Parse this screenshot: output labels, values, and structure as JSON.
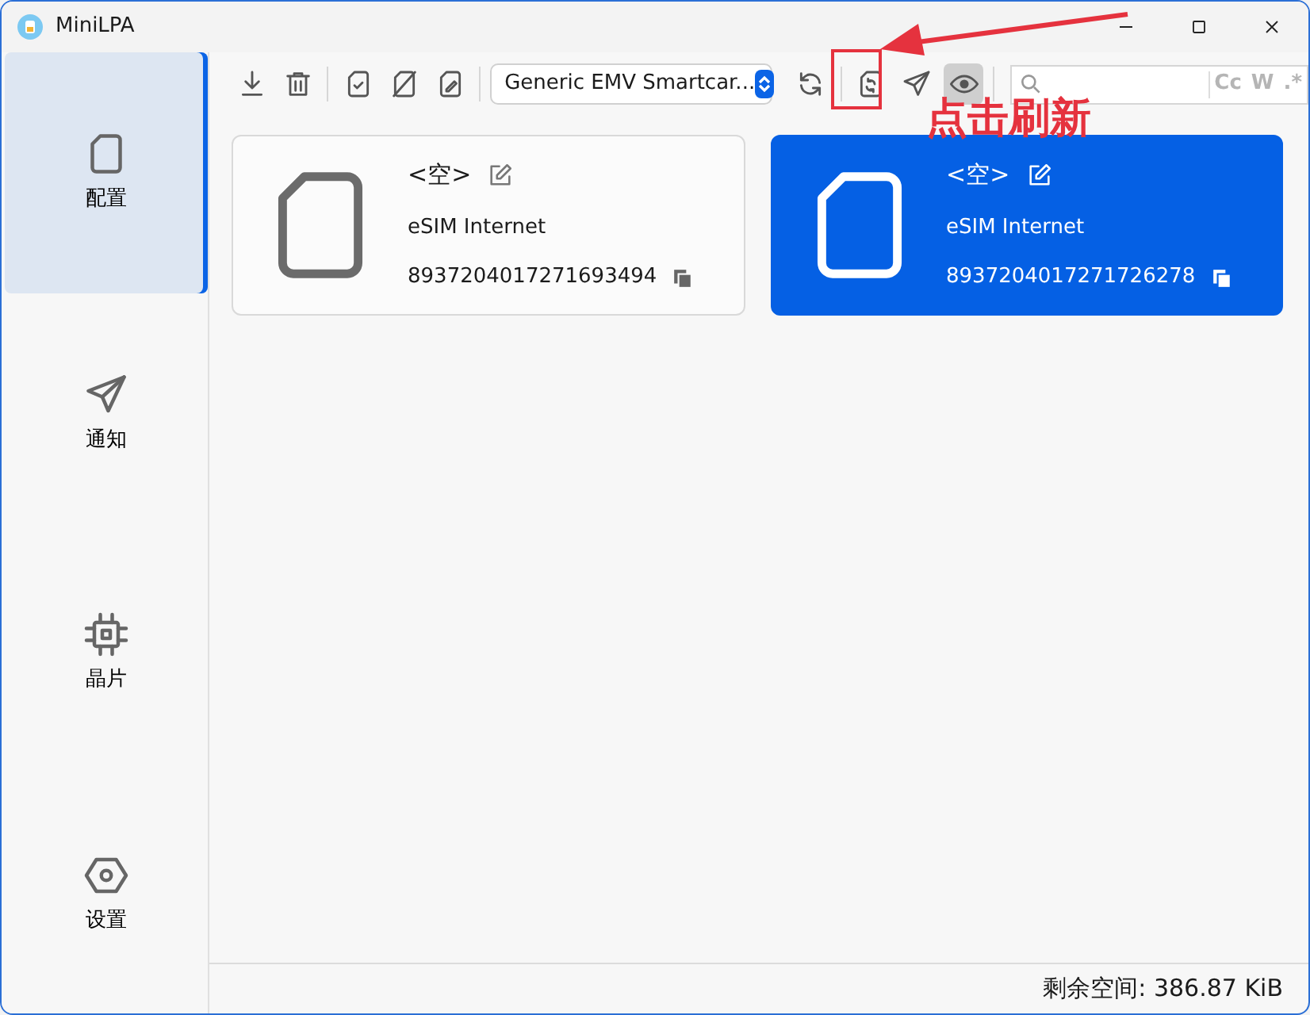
{
  "window": {
    "title": "MiniLPA"
  },
  "sidebar": {
    "items": [
      {
        "label": "配置",
        "kind": "sim",
        "selected": true
      },
      {
        "label": "通知",
        "kind": "plane",
        "selected": false
      },
      {
        "label": "晶片",
        "kind": "chip",
        "selected": false
      },
      {
        "label": "设置",
        "kind": "gear",
        "selected": false
      }
    ]
  },
  "toolbar": {
    "reader": "Generic EMV Smartcar...",
    "eye_on": true,
    "search_toggles": [
      "Cc",
      "W",
      ".*"
    ]
  },
  "profiles": [
    {
      "name": "<空>",
      "description": "eSIM Internet",
      "iccid": "8937204017271693494",
      "selected": false
    },
    {
      "name": "<空>",
      "description": "eSIM Internet",
      "iccid": "8937204017271726278",
      "selected": true
    }
  ],
  "annotation": {
    "text": "点击刷新"
  },
  "status_bar": {
    "text": "剩余空间: 386.87 KiB"
  }
}
